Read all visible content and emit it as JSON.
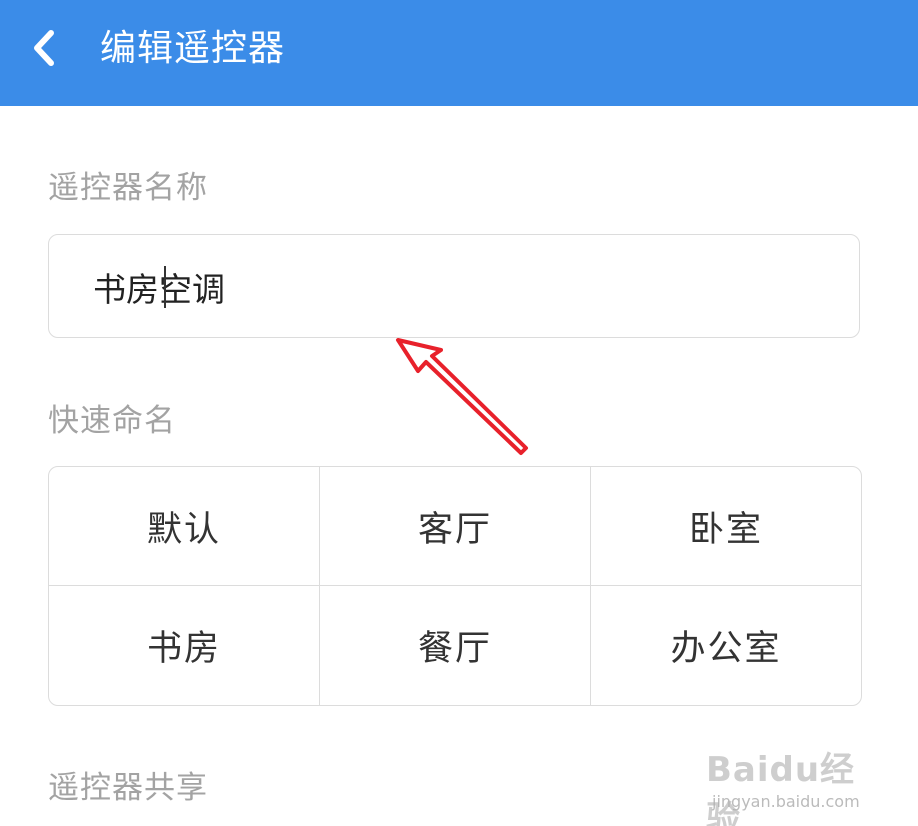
{
  "header": {
    "back_icon": "chevron-left-icon",
    "title": "编辑遥控器"
  },
  "name_section": {
    "label": "遥控器名称",
    "value": "书房空调"
  },
  "quick_section": {
    "label": "快速命名",
    "options": [
      "默认",
      "客厅",
      "卧室",
      "书房",
      "餐厅",
      "办公室"
    ]
  },
  "share_section": {
    "label": "遥控器共享"
  },
  "annotation": {
    "arrow_color": "#e8212b"
  },
  "watermark": {
    "logo_text": "Baidu经验",
    "url": "jingyan.baidu.com"
  },
  "colors": {
    "header_bg": "#3b8ce8",
    "label": "#a3a3a3",
    "text": "#333333",
    "border": "#dcdcdc"
  }
}
